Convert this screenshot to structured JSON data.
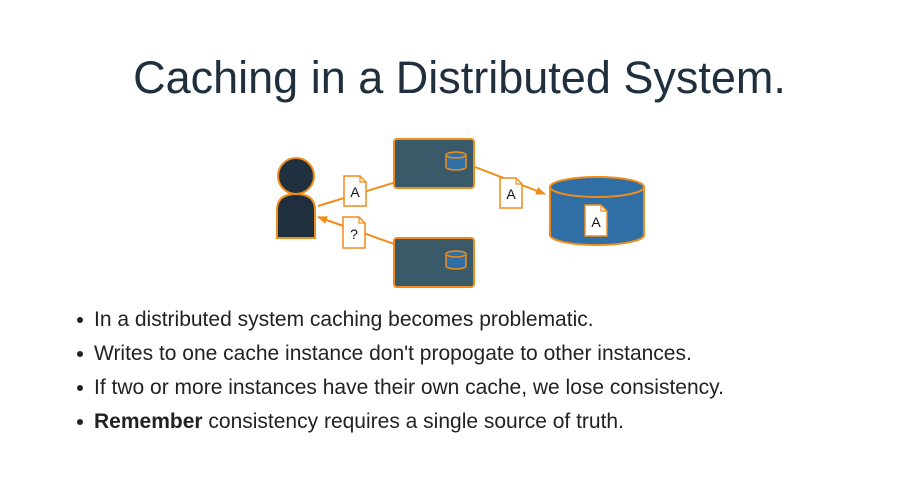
{
  "title": "Caching in a Distributed System.",
  "diagram": {
    "doc_top_left": "A",
    "doc_bottom_left": "?",
    "doc_middle": "A",
    "doc_database": "A",
    "colors": {
      "accent": "#f08c1a",
      "box_fill": "#3a5a6a",
      "db_fill": "#2f6fa6",
      "user_fill": "#1f2f3d"
    }
  },
  "bullets": [
    {
      "text": "In a distributed system caching becomes problematic."
    },
    {
      "text": "Writes to one cache instance don't propogate to other instances."
    },
    {
      "text": "If two or more instances have their own cache, we lose consistency."
    },
    {
      "strong": "Remember",
      "text": " consistency requires a single source of truth."
    }
  ]
}
